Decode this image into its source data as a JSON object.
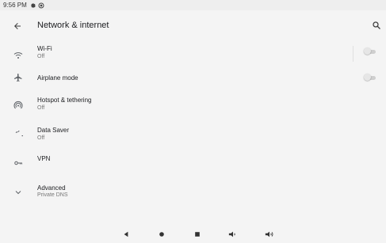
{
  "status_bar": {
    "time": "9:56 PM",
    "icons": [
      "settings-status-icon",
      "shield-status-icon"
    ]
  },
  "app_bar": {
    "title": "Network & internet",
    "back_icon": "arrow-back-icon",
    "search_icon": "search-icon"
  },
  "settings": [
    {
      "id": "wifi",
      "icon": "wifi-icon",
      "title": "Wi-Fi",
      "summary": "Off",
      "toggle": "off"
    },
    {
      "id": "airplane",
      "icon": "airplane-icon",
      "title": "Airplane mode",
      "summary": "",
      "toggle": "off"
    },
    {
      "id": "hotspot",
      "icon": "hotspot-icon",
      "title": "Hotspot & tethering",
      "summary": "Off"
    },
    {
      "id": "data-saver",
      "icon": "data-saver-icon",
      "title": "Data Saver",
      "summary": "Off"
    },
    {
      "id": "vpn",
      "icon": "vpn-key-icon",
      "title": "VPN",
      "summary": ""
    },
    {
      "id": "advanced",
      "icon": "chevron-down-icon",
      "title": "Advanced",
      "summary": "Private DNS"
    }
  ],
  "nav_bar": [
    "back-nav-icon",
    "home-nav-icon",
    "recents-nav-icon",
    "volume-down-icon",
    "volume-up-icon"
  ],
  "colors": {
    "background": "#f4f4f4",
    "text": "#202124",
    "secondary_text": "#777777",
    "toggle_off": "#cfcfcf"
  }
}
